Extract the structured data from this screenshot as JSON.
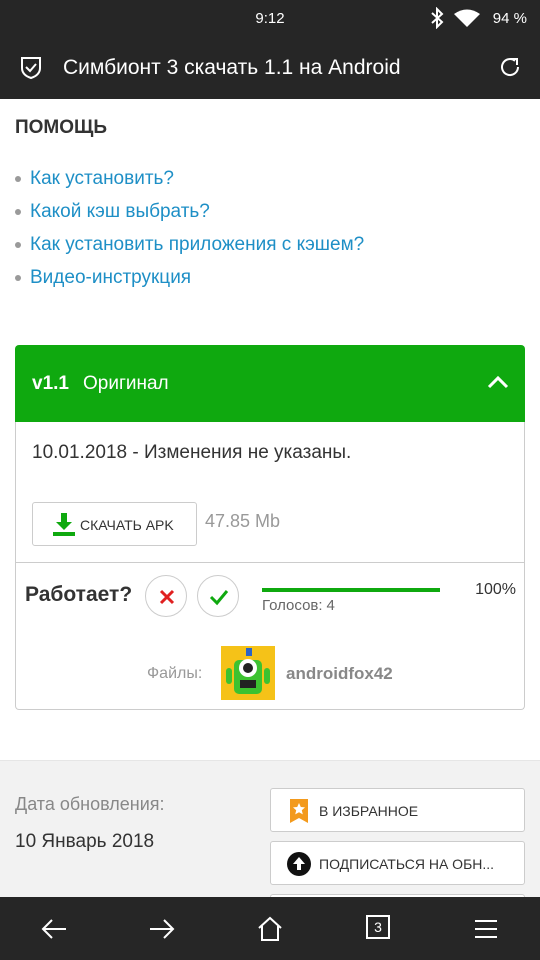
{
  "status_bar": {
    "time": "9:12",
    "battery": "94 %"
  },
  "toolbar": {
    "title": "Симбионт 3 скачать 1.1 на Android"
  },
  "help": {
    "title": "ПОМОЩЬ",
    "links": [
      "Как установить?",
      "Какой кэш выбрать?",
      "Как установить приложения с кэшем?",
      "Видео-инструкция"
    ]
  },
  "version": {
    "number": "v1.1",
    "type": "Оригинал",
    "changes": "10.01.2018 - Изменения не указаны.",
    "download_label": "СКАЧАТЬ APK",
    "size": "47.85 Mb",
    "works_label": "Работает?",
    "percent": "100%",
    "progress": 1.0,
    "votes_label": "Голосов:",
    "votes_count": "4",
    "files_label": "Файлы:",
    "uploader": "androidfox42"
  },
  "details": {
    "update_label": "Дата обновления:",
    "update_date": "10 Январь 2018",
    "favorite_label": "В ИЗБРАННОЕ",
    "subscribe_label": "ПОДПИСАТЬСЯ НА ОБН..."
  },
  "nav": {
    "tab_count": "3"
  },
  "colors": {
    "accent_green": "#0fa90f",
    "link_blue": "#1e8fc6",
    "bar_dark": "#262626",
    "favorite_orange": "#f39a1d"
  }
}
